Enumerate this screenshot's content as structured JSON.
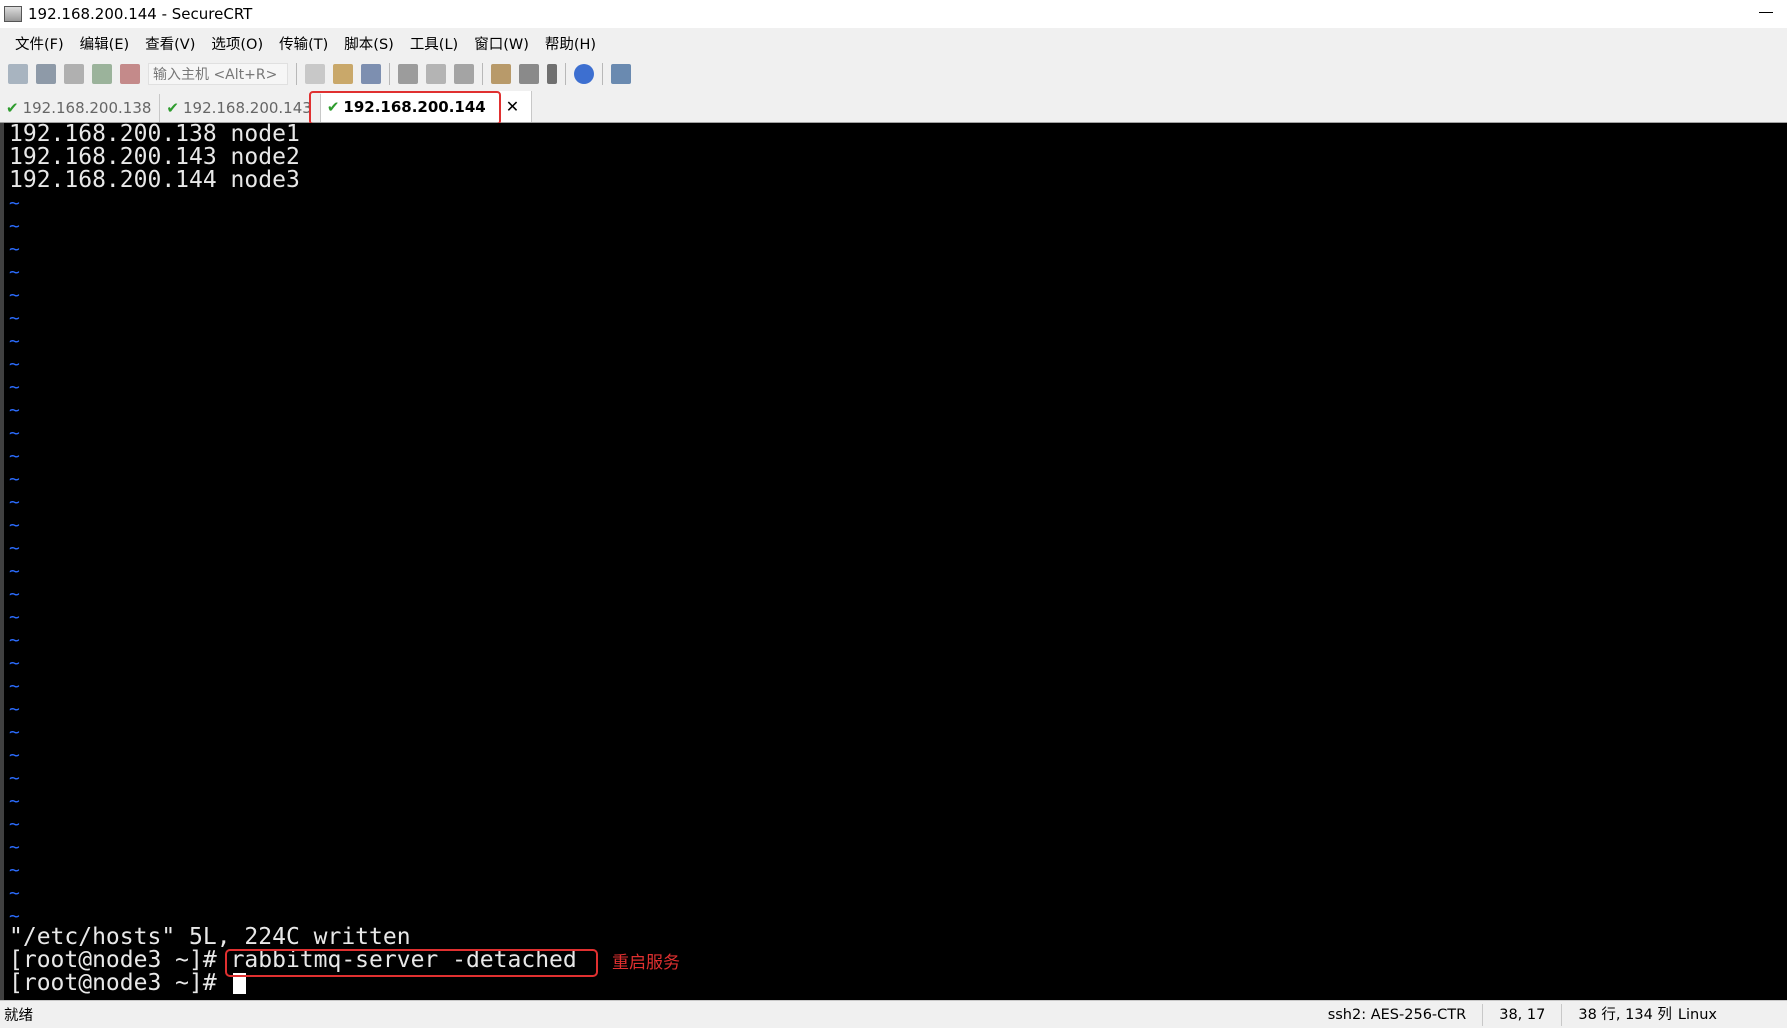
{
  "window": {
    "title": "192.168.200.144 - SecureCRT"
  },
  "menubar": {
    "items": [
      "文件(F)",
      "编辑(E)",
      "查看(V)",
      "选项(O)",
      "传输(T)",
      "脚本(S)",
      "工具(L)",
      "窗口(W)",
      "帮助(H)"
    ]
  },
  "toolbar": {
    "quick_connect_placeholder": "输入主机 <Alt+R>",
    "icons": [
      "connect-icon",
      "quick-connect-icon",
      "connect-in-tab-icon",
      "reconnect-icon",
      "disconnect-icon",
      "copy-icon",
      "paste-icon",
      "find-icon",
      "print-icon",
      "print-setup-icon",
      "print-selection-icon",
      "sftp-icon",
      "session-options-icon",
      "key-agent-icon",
      "help-icon",
      "map-keys-icon"
    ]
  },
  "tabs": [
    {
      "label": "192.168.200.138",
      "active": false
    },
    {
      "label": "192.168.200.143",
      "active": false
    },
    {
      "label": "192.168.200.144",
      "active": true
    }
  ],
  "terminal": {
    "hosts_lines": [
      "192.168.200.138 node1",
      "192.168.200.143 node2",
      "192.168.200.144 node3"
    ],
    "tilde_char": "~",
    "write_msg": "\"/etc/hosts\" 5L, 224C written",
    "prompt": "[root@node3 ~]# ",
    "command": "rabbitmq-server -detached",
    "annotation": "重启服务"
  },
  "status": {
    "ready": "就绪",
    "cipher": "ssh2: AES-256-CTR",
    "position": "38,  17",
    "size": "38 行, 134 列",
    "os": "Linux"
  },
  "colors": {
    "annotation_red": "#e03030",
    "tilde_blue": "#2b6cff",
    "check_green": "#2e9c2e"
  }
}
